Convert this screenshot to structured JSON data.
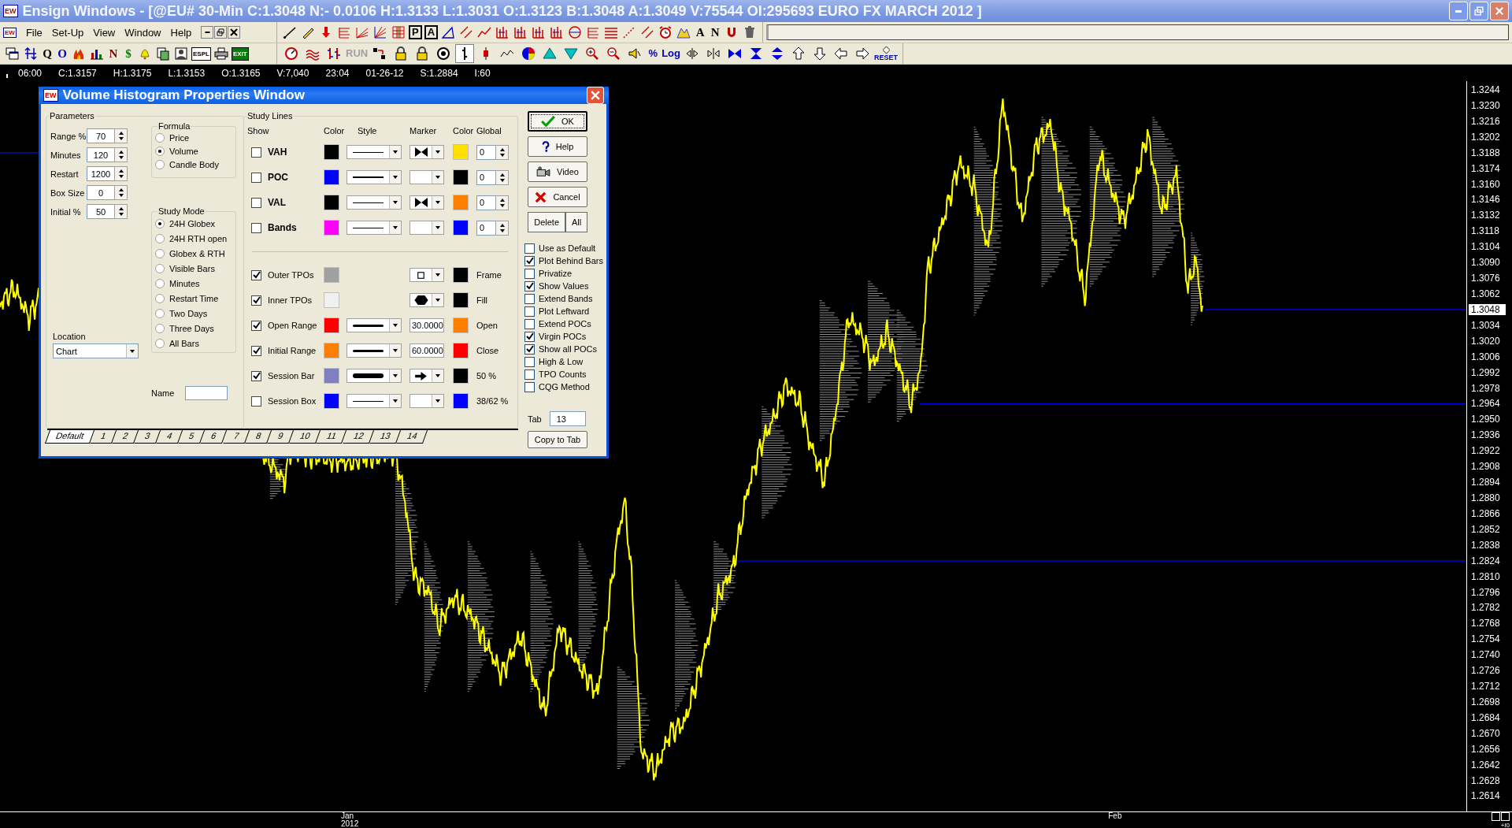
{
  "window": {
    "logo": "EW",
    "title": "Ensign Windows - [@EU# 30-Min C:1.3048 N:- 0.0106 H:1.3133 L:1.3031 O:1.3123 B:1.3048 A:1.3049 V:75544 OI:295693 EURO FX MARCH 2012 ]"
  },
  "menu": {
    "logo": "EW",
    "items": [
      "File",
      "Set-Up",
      "View",
      "Window",
      "Help"
    ]
  },
  "drawing_tools": [
    {
      "kind": "line"
    },
    {
      "kind": "pencil"
    },
    {
      "kind": "arrow-down"
    },
    {
      "kind": "fib-lines"
    },
    {
      "kind": "fan-lines"
    },
    {
      "kind": "fan"
    },
    {
      "kind": "grid"
    },
    {
      "kind": "boxed",
      "label": "P"
    },
    {
      "kind": "boxed",
      "label": "A"
    },
    {
      "kind": "triangle"
    },
    {
      "kind": "parallel"
    },
    {
      "kind": "zigzag"
    },
    {
      "kind": "bars"
    },
    {
      "kind": "bars"
    },
    {
      "kind": "bars"
    },
    {
      "kind": "bars"
    },
    {
      "kind": "circle"
    },
    {
      "kind": "fib-lines"
    },
    {
      "kind": "hlines"
    },
    {
      "kind": "dotted-line"
    },
    {
      "kind": "parallel"
    },
    {
      "kind": "alarm-clock"
    },
    {
      "kind": "mountain"
    },
    {
      "kind": "glyph",
      "label": "A",
      "color": "#000000"
    },
    {
      "kind": "glyph",
      "label": "N",
      "color": "#000000"
    },
    {
      "kind": "magnet"
    },
    {
      "kind": "trash"
    }
  ],
  "main_tools": [
    {
      "kind": "windows"
    },
    {
      "kind": "updown"
    },
    {
      "kind": "glyph",
      "label": "Q",
      "color": "#000000"
    },
    {
      "kind": "glyph",
      "label": "O",
      "color": "#0000c0"
    },
    {
      "kind": "fire"
    },
    {
      "kind": "bar-chart"
    },
    {
      "kind": "glyph",
      "label": "N",
      "color": "#800000"
    },
    {
      "kind": "glyph",
      "label": "$",
      "color": "#008000"
    },
    {
      "kind": "bell"
    },
    {
      "kind": "document"
    },
    {
      "kind": "figure"
    },
    {
      "kind": "badge",
      "label": "ESPL",
      "color": "#ffffff"
    },
    {
      "kind": "printer"
    },
    {
      "kind": "badge",
      "label": "EXIT",
      "color": "#008000"
    }
  ],
  "chart_tools": [
    {
      "kind": "gauge",
      "pressed": false
    },
    {
      "kind": "waves",
      "pressed": false
    },
    {
      "kind": "ticks",
      "pressed": false
    },
    {
      "kind": "glyph",
      "label": "RUN",
      "color": "#a0a0a0",
      "pressed": false
    },
    {
      "kind": "cursor",
      "pressed": false
    },
    {
      "kind": "lock",
      "pressed": false
    },
    {
      "kind": "lock",
      "pressed": false
    },
    {
      "kind": "target",
      "pressed": false
    },
    {
      "kind": "bar",
      "pressed": true
    },
    {
      "kind": "candle",
      "pressed": false
    },
    {
      "kind": "wave",
      "pressed": false
    },
    {
      "kind": "color-wheel",
      "pressed": false
    },
    {
      "kind": "triangle-up",
      "pressed": false
    },
    {
      "kind": "triangle-down",
      "pressed": false
    },
    {
      "kind": "zoom-in",
      "pressed": false
    },
    {
      "kind": "zoom-out",
      "pressed": false
    },
    {
      "kind": "speaker",
      "pressed": false
    },
    {
      "kind": "glyph",
      "label": "%",
      "color": "#0000c0",
      "pressed": false
    },
    {
      "kind": "glyph",
      "label": "Log",
      "color": "#0000c0",
      "pressed": false
    },
    {
      "kind": "split-left",
      "pressed": false
    },
    {
      "kind": "split-right",
      "pressed": false
    },
    {
      "kind": "bowtie",
      "pressed": false
    },
    {
      "kind": "hourglass",
      "pressed": false
    },
    {
      "kind": "double-arrow",
      "pressed": false
    },
    {
      "kind": "arrow-up",
      "pressed": false
    },
    {
      "kind": "arrow-down-outline",
      "pressed": false
    },
    {
      "kind": "arrow-left",
      "pressed": false
    },
    {
      "kind": "arrow-right",
      "pressed": false
    },
    {
      "kind": "reset",
      "label": "RESET",
      "pressed": false
    }
  ],
  "status_line": [
    "06:00",
    "C:1.3157",
    "H:1.3175",
    "L:1.3153",
    "O:1.3165",
    "V:7,040",
    "23:04",
    "01-26-12",
    "S:1.2884",
    "I:60"
  ],
  "price_axis": [
    {
      "text": "1.3244",
      "current": false
    },
    {
      "text": "1.3230",
      "current": false
    },
    {
      "text": "1.3216",
      "current": false
    },
    {
      "text": "1.3202",
      "current": false
    },
    {
      "text": "1.3188",
      "current": false
    },
    {
      "text": "1.3174",
      "current": false
    },
    {
      "text": "1.3160",
      "current": false
    },
    {
      "text": "1.3146",
      "current": false
    },
    {
      "text": "1.3132",
      "current": false
    },
    {
      "text": "1.3118",
      "current": false
    },
    {
      "text": "1.3104",
      "current": false
    },
    {
      "text": "1.3090",
      "current": false
    },
    {
      "text": "1.3076",
      "current": false
    },
    {
      "text": "1.3062",
      "current": false
    },
    {
      "text": "1.3048",
      "current": true
    },
    {
      "text": "1.3034",
      "current": false
    },
    {
      "text": "1.3020",
      "current": false
    },
    {
      "text": "1.3006",
      "current": false
    },
    {
      "text": "1.2992",
      "current": false
    },
    {
      "text": "1.2978",
      "current": false
    },
    {
      "text": "1.2964",
      "current": false
    },
    {
      "text": "1.2950",
      "current": false
    },
    {
      "text": "1.2936",
      "current": false
    },
    {
      "text": "1.2922",
      "current": false
    },
    {
      "text": "1.2908",
      "current": false
    },
    {
      "text": "1.2894",
      "current": false
    },
    {
      "text": "1.2880",
      "current": false
    },
    {
      "text": "1.2866",
      "current": false
    },
    {
      "text": "1.2852",
      "current": false
    },
    {
      "text": "1.2838",
      "current": false
    },
    {
      "text": "1.2824",
      "current": false
    },
    {
      "text": "1.2810",
      "current": false
    },
    {
      "text": "1.2796",
      "current": false
    },
    {
      "text": "1.2782",
      "current": false
    },
    {
      "text": "1.2768",
      "current": false
    },
    {
      "text": "1.2754",
      "current": false
    },
    {
      "text": "1.2740",
      "current": false
    },
    {
      "text": "1.2726",
      "current": false
    },
    {
      "text": "1.2712",
      "current": false
    },
    {
      "text": "1.2698",
      "current": false
    },
    {
      "text": "1.2684",
      "current": false
    },
    {
      "text": "1.2670",
      "current": false
    },
    {
      "text": "1.2656",
      "current": false
    },
    {
      "text": "1.2642",
      "current": false
    },
    {
      "text": "1.2628",
      "current": false
    },
    {
      "text": "1.2614",
      "current": false
    }
  ],
  "time_axis": [
    {
      "label": "Jan",
      "year": "2012"
    },
    {
      "label": "Feb"
    }
  ],
  "corner_label": "+I0",
  "dialog": {
    "logo": "EW",
    "title": "Volume Histogram Properties Window",
    "parameters": {
      "label": "Parameters",
      "fields": [
        {
          "label": "Range %",
          "value": "70"
        },
        {
          "label": "Minutes",
          "value": "120"
        },
        {
          "label": "Restart",
          "value": "1200"
        },
        {
          "label": "Box Size",
          "value": "0"
        },
        {
          "label": "Initial %",
          "value": "50"
        }
      ]
    },
    "formula": {
      "label": "Formula",
      "options": [
        {
          "label": "Price",
          "selected": false
        },
        {
          "label": "Volume",
          "selected": true
        },
        {
          "label": "Candle Body",
          "selected": false
        }
      ]
    },
    "study_mode": {
      "label": "Study Mode",
      "options": [
        {
          "label": "24H Globex",
          "selected": true
        },
        {
          "label": "24H RTH open",
          "selected": false
        },
        {
          "label": "Globex & RTH",
          "selected": false
        },
        {
          "label": "Visible Bars",
          "selected": false
        },
        {
          "label": "Minutes",
          "selected": false
        },
        {
          "label": "Restart Time",
          "selected": false
        },
        {
          "label": "Two Days",
          "selected": false
        },
        {
          "label": "Three Days",
          "selected": false
        },
        {
          "label": "All Bars",
          "selected": false
        }
      ]
    },
    "location": {
      "label": "Location",
      "value": "Chart"
    },
    "name": {
      "label": "Name"
    },
    "study_lines": {
      "label": "Study Lines",
      "headers": [
        "Show",
        "Color",
        "Style",
        "Marker",
        "Color",
        "Global"
      ],
      "lines": [
        {
          "label": "VAH",
          "checked": false,
          "swatches": [
            {
              "color": "#000000"
            },
            {
              "color": "#ffe000"
            }
          ],
          "global": "0"
        },
        {
          "label": "POC",
          "checked": false,
          "swatches": [
            {
              "color": "#0000ff"
            },
            {
              "color": "#000000"
            }
          ],
          "global": "0"
        },
        {
          "label": "VAL",
          "checked": false,
          "swatches": [
            {
              "color": "#000000"
            },
            {
              "color": "#ff8000"
            }
          ],
          "global": "0"
        },
        {
          "label": "Bands",
          "checked": false,
          "swatches": [
            {
              "color": "#ff00ff"
            },
            {
              "color": "#0000ff"
            }
          ],
          "global": "0"
        }
      ],
      "tpo_lines": [
        {
          "label": "Outer TPOs",
          "checked": true,
          "kind": "marker",
          "swatches": [
            {
              "color": "#a0a0a0"
            },
            {
              "color": "#000000"
            }
          ],
          "note": "Frame"
        },
        {
          "label": "Inner TPOs",
          "checked": true,
          "kind": "marker",
          "swatches": [
            {
              "color": "#f0f0f0"
            },
            {
              "color": "#000000"
            }
          ],
          "note": "Fill"
        },
        {
          "label": "Open Range",
          "checked": true,
          "kind": "value",
          "value": "30.0000",
          "swatches": [
            {
              "color": "#ff0000"
            },
            {
              "color": "#ff8000"
            }
          ],
          "note": "Open"
        },
        {
          "label": "Initial Range",
          "checked": true,
          "kind": "value",
          "value": "60.0000",
          "swatches": [
            {
              "color": "#ff8000"
            },
            {
              "color": "#ff0000"
            }
          ],
          "note": "Close"
        },
        {
          "label": "Session Bar",
          "checked": true,
          "kind": "marker",
          "swatches": [
            {
              "color": "#8080c0"
            },
            {
              "color": "#000000"
            }
          ],
          "note": "50 %"
        },
        {
          "label": "Session Box",
          "checked": false,
          "kind": "marker",
          "swatches": [
            {
              "color": "#0000ff"
            },
            {
              "color": "#0000ff"
            }
          ],
          "note": "38/62 %"
        }
      ]
    },
    "buttons": [
      {
        "label": "OK",
        "kind": "ok"
      },
      {
        "label": "Help",
        "kind": "help"
      },
      {
        "label": "Video",
        "kind": "video"
      },
      {
        "label": "Cancel",
        "kind": "cancel"
      }
    ],
    "delete_buttons": [
      "Delete",
      "All"
    ],
    "options": [
      {
        "label": "Use as Default",
        "checked": false
      },
      {
        "label": "Plot Behind Bars",
        "checked": true
      },
      {
        "label": "Privatize",
        "checked": false
      },
      {
        "label": "Show Values",
        "checked": true
      },
      {
        "label": "Extend Bands",
        "checked": false
      },
      {
        "label": "Plot Leftward",
        "checked": false
      },
      {
        "label": "Extend POCs",
        "checked": false
      },
      {
        "label": "Virgin POCs",
        "checked": true
      },
      {
        "label": "Show all POCs",
        "checked": true
      },
      {
        "label": "High & Low",
        "checked": false
      },
      {
        "label": "TPO Counts",
        "checked": false
      },
      {
        "label": "CQG Method",
        "checked": false
      }
    ],
    "tab_field": {
      "label": "Tab",
      "value": "13"
    },
    "copy_button": "Copy to Tab",
    "tabs": [
      {
        "label": "Default",
        "selected": true
      },
      {
        "label": "1",
        "selected": false
      },
      {
        "label": "2",
        "selected": false
      },
      {
        "label": "3",
        "selected": false
      },
      {
        "label": "4",
        "selected": false
      },
      {
        "label": "5",
        "selected": false
      },
      {
        "label": "6",
        "selected": false
      },
      {
        "label": "7",
        "selected": false
      },
      {
        "label": "8",
        "selected": false
      },
      {
        "label": "9",
        "selected": false
      },
      {
        "label": "10",
        "selected": false
      },
      {
        "label": "11",
        "selected": false
      },
      {
        "label": "12",
        "selected": false
      },
      {
        "label": "13",
        "selected": false
      },
      {
        "label": "14",
        "selected": false
      }
    ]
  }
}
